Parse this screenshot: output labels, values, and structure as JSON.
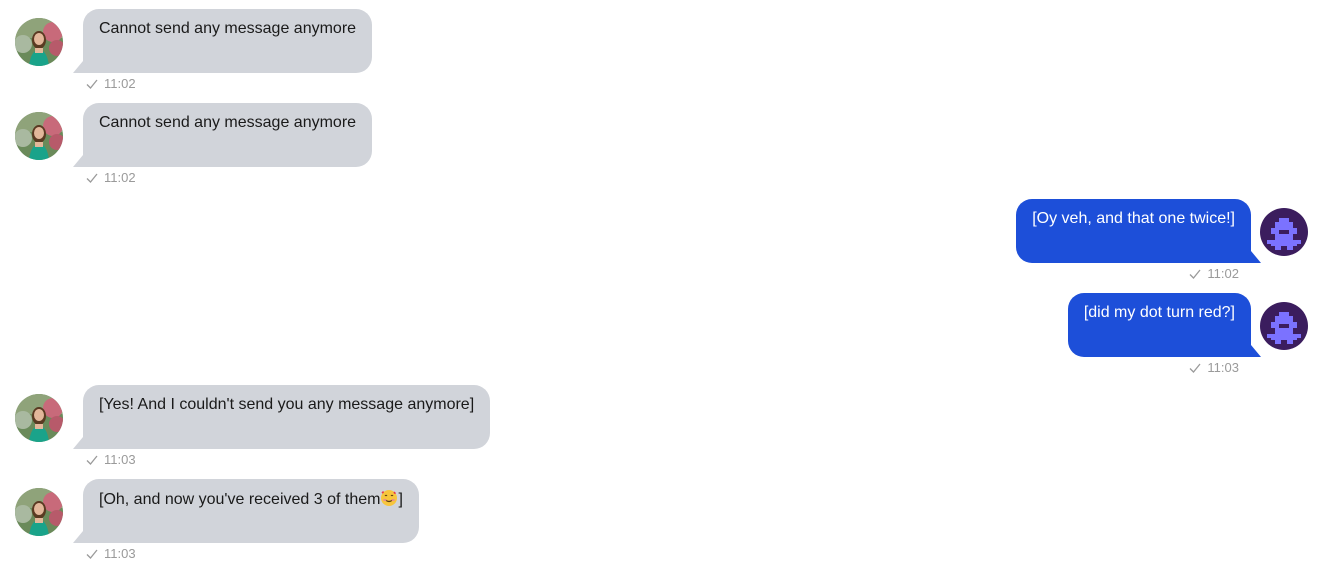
{
  "messages": [
    {
      "direction": "in",
      "text": "Cannot send any message anymore",
      "time": "11:02",
      "status_icon": "check-icon"
    },
    {
      "direction": "in",
      "text": "Cannot send any message anymore",
      "time": "11:02",
      "status_icon": "check-icon"
    },
    {
      "direction": "out",
      "text": "[Oy veh, and that one twice!]",
      "time": "11:02",
      "status_icon": "check-icon"
    },
    {
      "direction": "out",
      "text": "[did my dot turn red?]",
      "time": "11:03",
      "status_icon": "check-icon"
    },
    {
      "direction": "in",
      "text": "[Yes! And I couldn't send you any message anymore]",
      "time": "11:03",
      "status_icon": "check-icon"
    },
    {
      "direction": "in",
      "text_before_emoji": "[Oh, and now you've received 3 of them",
      "emoji": "smiling-face-with-hearts-emoji",
      "text_after_emoji": "]",
      "time": "11:03",
      "status_icon": "check-icon"
    }
  ],
  "avatars": {
    "contact": "contact-photo-avatar",
    "self": "pixel-invader-avatar"
  },
  "colors": {
    "incoming_bubble": "#d1d4da",
    "outgoing_bubble": "#1d4fd9",
    "self_avatar_bg": "#3b1d5e",
    "self_avatar_fg": "#7b72ff",
    "meta_text": "#9a9a9a"
  }
}
